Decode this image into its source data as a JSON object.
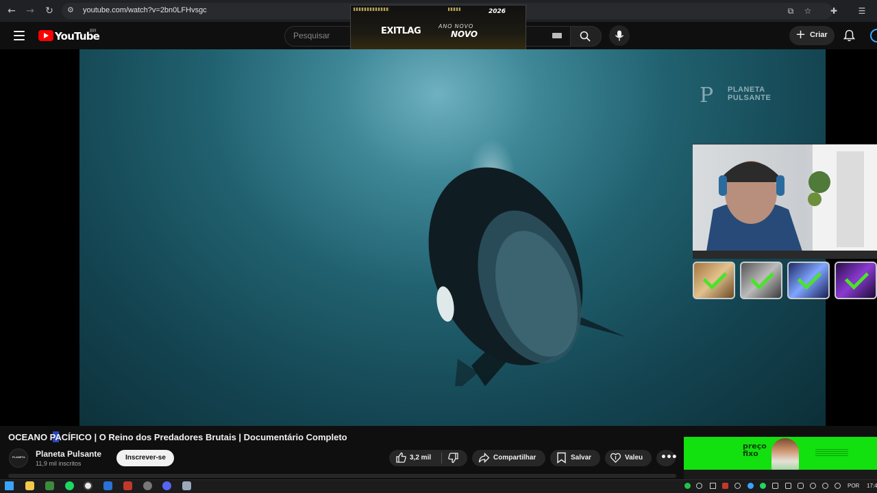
{
  "browser": {
    "url": "youtube.com/watch?v=2bn0LFHvsgc",
    "nav_icons": [
      "back-icon",
      "forward-icon",
      "reload-icon",
      "site-info-icon"
    ],
    "right_icons": [
      "install-app-icon",
      "bookmark-star-icon",
      "extensions-icon",
      "reading-list-icon"
    ]
  },
  "youtube_header": {
    "logo_text": "YouTube",
    "region": "BR",
    "search_placeholder": "Pesquisar",
    "create_label": "Criar"
  },
  "overlay_ad": {
    "brand": "EXITLAG",
    "tagline": "ANO NOVO",
    "tagline2": "NOVO",
    "year": "2026"
  },
  "video": {
    "watermark": {
      "line1": "PLANETA",
      "line2": "PULSANTE"
    },
    "title_prefix": "OCEANO ",
    "title_caret_letter": "P",
    "title_rest": "ACÍFICO | O Reino dos Predadores Brutais | Documentário Completo"
  },
  "channel": {
    "name": "Planeta Pulsante",
    "subscribers": "11,9 mil inscritos",
    "avatar_text": "PLANETA",
    "subscribe_label": "Inscrever-se"
  },
  "actions": {
    "likes": "3,2 mil",
    "share": "Compartilhar",
    "save": "Salvar",
    "thanks": "Valeu"
  },
  "side_ad": {
    "line1": "preço",
    "line2": "fixo"
  },
  "taskbar": {
    "language": "POR",
    "time": "17:4"
  },
  "colors": {
    "youtube_red": "#ff0000",
    "check_green": "#4be32b",
    "ad_green": "#13e00f"
  }
}
